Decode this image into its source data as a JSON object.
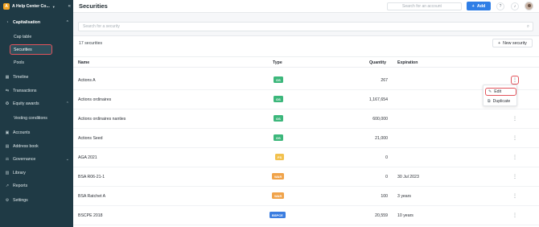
{
  "org": {
    "initial": "A",
    "name": "A Help Center Co..."
  },
  "sidebar": {
    "items": [
      {
        "label": "Capitalisation",
        "icon": "pie-chart-icon"
      },
      {
        "label": "Cap table"
      },
      {
        "label": "Securities"
      },
      {
        "label": "Pools"
      },
      {
        "label": "Timeline",
        "icon": "calendar-icon"
      },
      {
        "label": "Transactions",
        "icon": "transfer-icon"
      },
      {
        "label": "Equity awards",
        "icon": "award-icon"
      },
      {
        "label": "Vesting conditions"
      },
      {
        "label": "Accounts",
        "icon": "accounts-icon"
      },
      {
        "label": "Address book",
        "icon": "book-icon"
      },
      {
        "label": "Governance",
        "icon": "gavel-icon"
      },
      {
        "label": "Library",
        "icon": "library-icon"
      },
      {
        "label": "Reports",
        "icon": "reports-icon"
      },
      {
        "label": "Settings",
        "icon": "gear-icon"
      }
    ]
  },
  "header": {
    "title": "Securities",
    "search_placeholder": "Search for an account",
    "add_label": "Add"
  },
  "main": {
    "search_placeholder": "Search for a security",
    "count_label": "17 securities",
    "new_security_label": "New security",
    "columns": [
      "Name",
      "Type",
      "Quantity",
      "Expiration"
    ],
    "rows": [
      {
        "name": "Actions A",
        "type": "OS",
        "type_color": "#3cb77b",
        "quantity": "267",
        "expiration": ""
      },
      {
        "name": "Actions ordinaires",
        "type": "OS",
        "type_color": "#3cb77b",
        "quantity": "1,167,654",
        "expiration": ""
      },
      {
        "name": "Actions ordinaires nanties",
        "type": "OS",
        "type_color": "#3cb77b",
        "quantity": "600,000",
        "expiration": ""
      },
      {
        "name": "Actions Seed",
        "type": "OS",
        "type_color": "#3cb77b",
        "quantity": "21,000",
        "expiration": ""
      },
      {
        "name": "AGA 2021",
        "type": "FS",
        "type_color": "#f2c14e",
        "quantity": "0",
        "expiration": ""
      },
      {
        "name": "BSA R06-21-1",
        "type": "WAR",
        "type_color": "#f0a34a",
        "quantity": "0",
        "expiration": "30 Jul 2023"
      },
      {
        "name": "BSA Ratchet A",
        "type": "WAR",
        "type_color": "#f0a34a",
        "quantity": "100",
        "expiration": "3 years"
      },
      {
        "name": "BSCPE 2018",
        "type": "BSPCE",
        "type_color": "#3b7de0",
        "quantity": "20,559",
        "expiration": "10 years"
      }
    ],
    "menu": {
      "edit_label": "Edit",
      "duplicate_label": "Duplicate"
    }
  },
  "colors": {
    "sidebar_bg": "#1f3a45",
    "accent": "#2f7ee6",
    "highlight": "#e2545c"
  }
}
